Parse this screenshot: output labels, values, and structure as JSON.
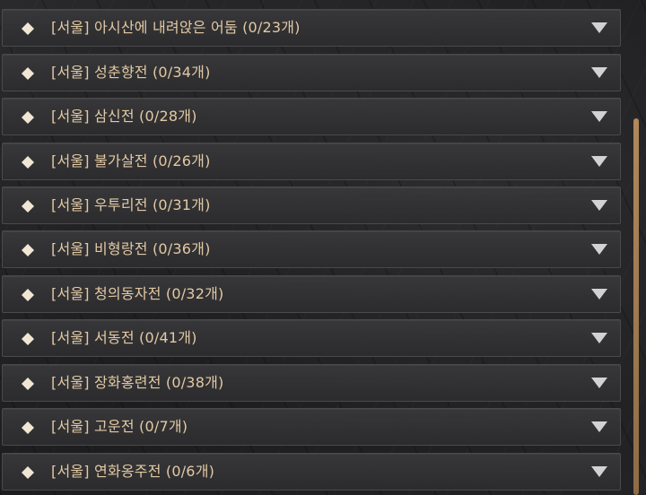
{
  "list": {
    "items": [
      {
        "label": "[서울] 아시산에 내려앉은 어둠 (0/23개)"
      },
      {
        "label": "[서울] 성춘향전 (0/34개)"
      },
      {
        "label": "[서울] 삼신전 (0/28개)"
      },
      {
        "label": "[서울] 불가살전 (0/26개)"
      },
      {
        "label": "[서울] 우투리전 (0/31개)"
      },
      {
        "label": "[서울] 비형랑전 (0/36개)"
      },
      {
        "label": "[서울] 청의동자전 (0/32개)"
      },
      {
        "label": "[서울] 서동전 (0/41개)"
      },
      {
        "label": "[서울] 장화홍련전 (0/38개)"
      },
      {
        "label": "[서울] 고운전 (0/7개)"
      },
      {
        "label": "[서울] 연화옹주전 (0/6개)"
      }
    ],
    "bullet_icon": "diamond-icon",
    "expand_icon": "triangle-down-icon"
  },
  "colors": {
    "label_text": "#e3c9a4",
    "bullet": "#f1e6d4",
    "chevron": "#d2d2d2",
    "scroll_thumb": "#a07b50"
  },
  "scrollbar": {
    "position_fraction": 0.24
  }
}
